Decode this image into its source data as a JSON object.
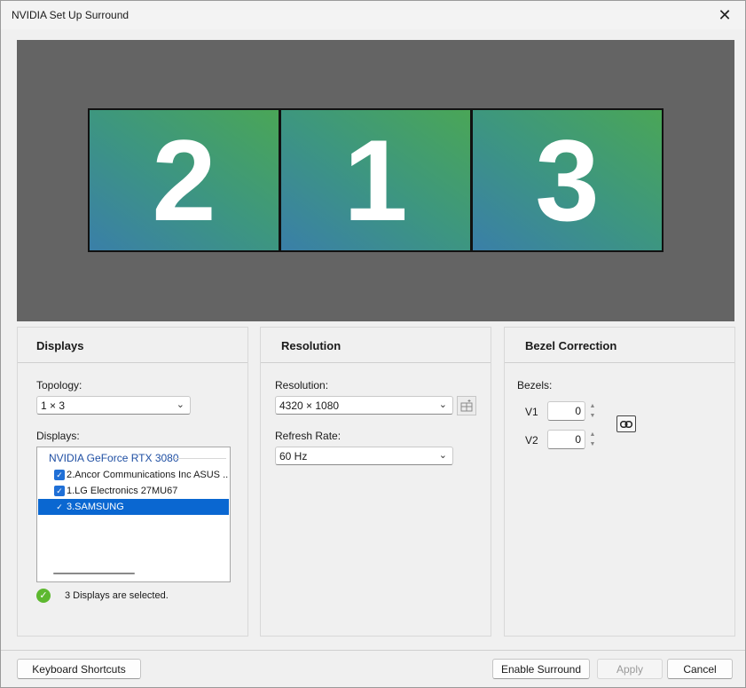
{
  "window": {
    "title": "NVIDIA Set Up Surround",
    "close_glyph": "✕"
  },
  "preview": {
    "monitors": [
      "2",
      "1",
      "3"
    ]
  },
  "displays_panel": {
    "title": "Displays",
    "topology_label": "Topology:",
    "topology_value": "1 × 3",
    "displays_label": "Displays:",
    "gpu_name": "NVIDIA GeForce RTX 3080",
    "items": [
      {
        "label": "2.Ancor Communications Inc ASUS ...",
        "checked": true,
        "selected": false
      },
      {
        "label": "1.LG Electronics 27MU67",
        "checked": true,
        "selected": false
      },
      {
        "label": "3.SAMSUNG",
        "checked": true,
        "selected": true
      }
    ],
    "status_text": "3 Displays are selected."
  },
  "resolution_panel": {
    "title": "Resolution",
    "resolution_label": "Resolution:",
    "resolution_value": "4320 × 1080",
    "refresh_label": "Refresh Rate:",
    "refresh_value": "60  Hz"
  },
  "bezel_panel": {
    "title": "Bezel Correction",
    "bezels_label": "Bezels:",
    "v1_label": "V1",
    "v1_value": "0",
    "v2_label": "V2",
    "v2_value": "0"
  },
  "footer": {
    "keyboard_shortcuts": "Keyboard Shortcuts",
    "enable_surround": "Enable Surround",
    "apply": "Apply",
    "cancel": "Cancel"
  },
  "colors": {
    "accent": "#0a67d1",
    "preview_bg": "#646464",
    "status_ok": "#5db82f"
  }
}
